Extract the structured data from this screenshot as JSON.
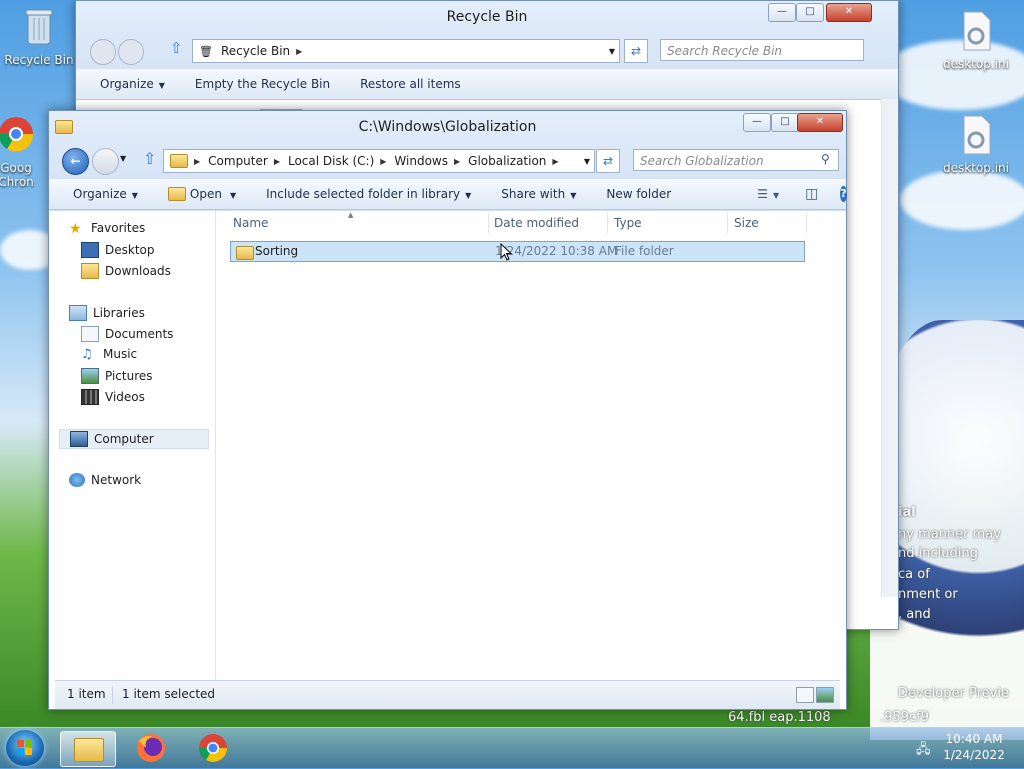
{
  "desktop": {
    "icons": [
      {
        "label": "Recycle Bin"
      },
      {
        "label": "Goog Chron"
      },
      {
        "label": "desktop.ini"
      },
      {
        "label": "desktop.ini"
      }
    ],
    "wallpaper_text": [
      "ial",
      "ny manner may",
      "nd including",
      "ca of",
      "nment or",
      ", and",
      "Developer Previe",
      "64.fbl eap.1108",
      ".959cf9"
    ]
  },
  "recycle_window": {
    "title": "Recycle Bin",
    "address": "Recycle Bin",
    "search_placeholder": "Search Recycle Bin",
    "toolbar": {
      "organize": "Organize",
      "empty": "Empty the Recycle Bin",
      "restore": "Restore all items"
    }
  },
  "explorer": {
    "title": "C:\\Windows\\Globalization",
    "breadcrumb": [
      "Computer",
      "Local Disk (C:)",
      "Windows",
      "Globalization"
    ],
    "search_placeholder": "Search Globalization",
    "toolbar": {
      "organize": "Organize",
      "open": "Open",
      "include": "Include selected folder in library",
      "share": "Share with",
      "new_folder": "New folder"
    },
    "nav": {
      "favorites": "Favorites",
      "desktop": "Desktop",
      "downloads": "Downloads",
      "libraries": "Libraries",
      "documents": "Documents",
      "music": "Music",
      "pictures": "Pictures",
      "videos": "Videos",
      "computer": "Computer",
      "network": "Network"
    },
    "columns": {
      "name": "Name",
      "date": "Date modified",
      "type": "Type",
      "size": "Size"
    },
    "files": [
      {
        "name": "Sorting",
        "date": "1/24/2022 10:38 AM",
        "type": "File folder",
        "size": ""
      }
    ],
    "status": {
      "count": "1 item",
      "selected": "1 item selected"
    }
  },
  "taskbar": {
    "time": "10:40 AM",
    "date": "1/24/2022"
  },
  "colors": {
    "accent": "#3b7bd4",
    "selection": "#cce4f7"
  }
}
